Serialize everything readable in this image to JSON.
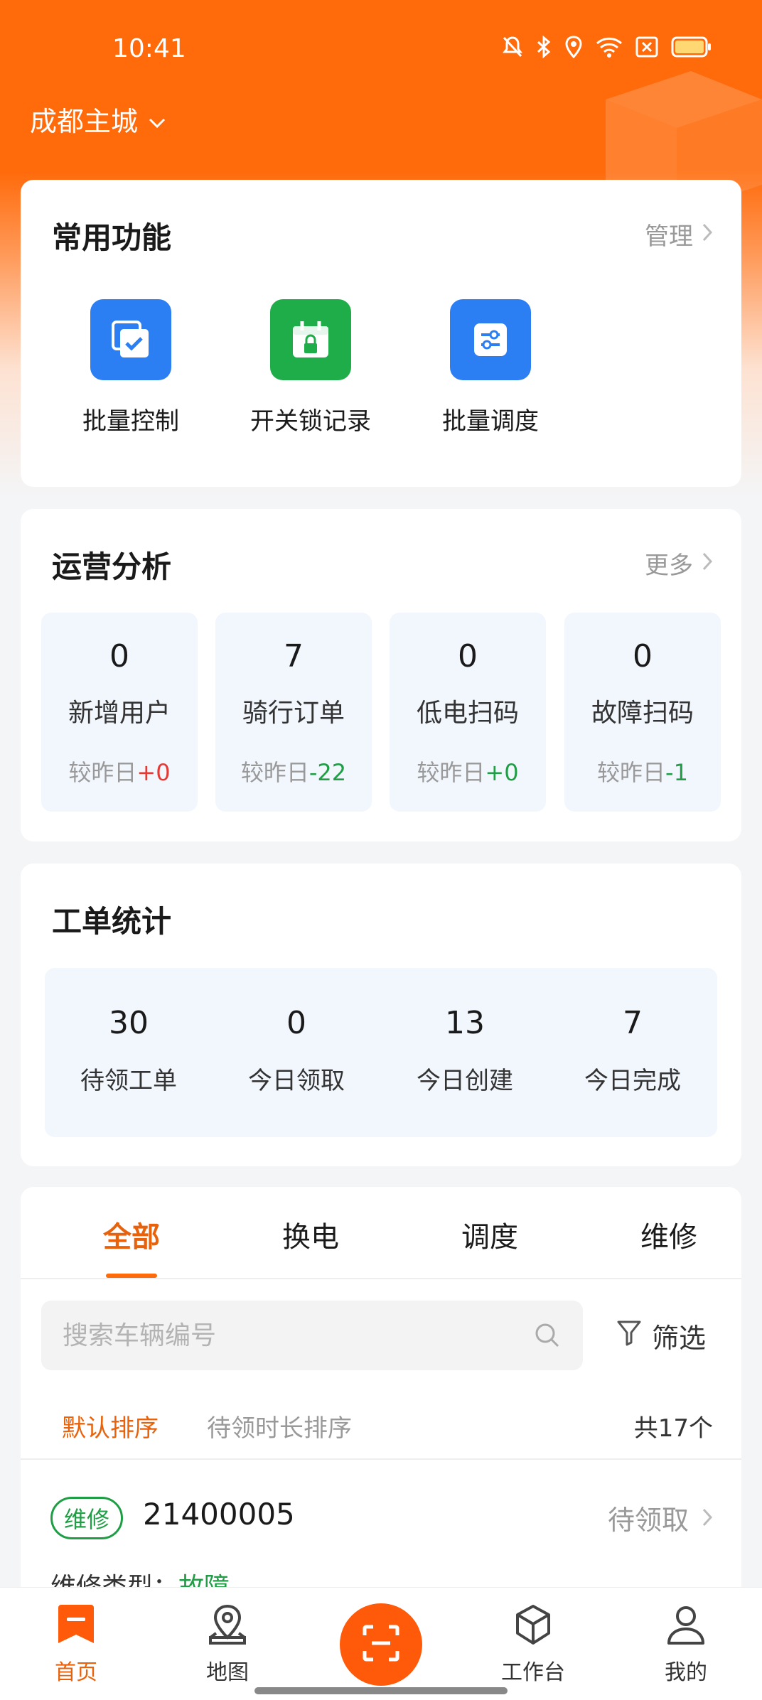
{
  "status_bar": {
    "time": "10:41"
  },
  "header": {
    "city": "成都主城"
  },
  "common_functions": {
    "title": "常用功能",
    "link": "管理",
    "items": [
      {
        "label": "批量控制",
        "icon": "batch-check-icon",
        "color": "#2b7ff3"
      },
      {
        "label": "开关锁记录",
        "icon": "calendar-lock-icon",
        "color": "#1fad4a"
      },
      {
        "label": "批量调度",
        "icon": "sliders-icon",
        "color": "#2b7ff3"
      }
    ]
  },
  "operations": {
    "title": "运营分析",
    "link": "更多",
    "compare_prefix": "较昨日",
    "stats": [
      {
        "value": "0",
        "label": "新增用户",
        "delta": "+0",
        "delta_color": "#e53935"
      },
      {
        "value": "7",
        "label": "骑行订单",
        "delta": "-22",
        "delta_color": "#1f9e45"
      },
      {
        "value": "0",
        "label": "低电扫码",
        "delta": "+0",
        "delta_color": "#1f9e45"
      },
      {
        "value": "0",
        "label": "故障扫码",
        "delta": "-1",
        "delta_color": "#1f9e45"
      }
    ]
  },
  "work_orders": {
    "title": "工单统计",
    "stats": [
      {
        "value": "30",
        "label": "待领工单"
      },
      {
        "value": "0",
        "label": "今日领取"
      },
      {
        "value": "13",
        "label": "今日创建"
      },
      {
        "value": "7",
        "label": "今日完成"
      }
    ]
  },
  "tabs": [
    {
      "label": "全部",
      "active": true
    },
    {
      "label": "换电",
      "active": false
    },
    {
      "label": "调度",
      "active": false
    },
    {
      "label": "维修",
      "active": false
    }
  ],
  "search": {
    "placeholder": "搜索车辆编号",
    "filter_label": "筛选"
  },
  "sort": {
    "default": "默认排序",
    "duration": "待领时长排序",
    "total": "共17个"
  },
  "order": {
    "tag": "维修",
    "number": "21400005",
    "status": "待领取",
    "type_label": "维修类型：",
    "type_value": "故障"
  },
  "bottom_nav": [
    {
      "label": "首页",
      "icon": "home-bookmark-icon",
      "active": true
    },
    {
      "label": "地图",
      "icon": "map-pin-icon",
      "active": false
    },
    {
      "label": "工作台",
      "icon": "cube-icon",
      "active": false
    },
    {
      "label": "我的",
      "icon": "user-icon",
      "active": false
    }
  ],
  "colors": {
    "brand": "#ff6a0a",
    "accent_text": "#e8620c",
    "repair_tag": "#1f9e45"
  }
}
